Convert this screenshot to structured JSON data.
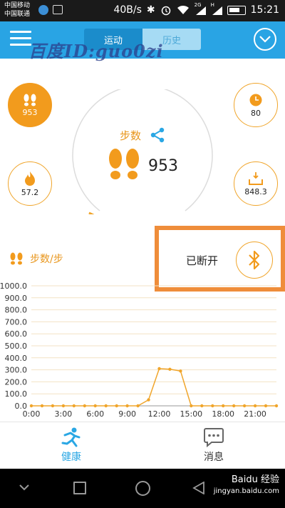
{
  "status_bar": {
    "carrier_1": "中国移动",
    "carrier_2": "中国联通",
    "net_speed": "40B/s",
    "network_label": "2G",
    "signal_label": "H",
    "time": "15:21"
  },
  "header": {
    "tabs": [
      {
        "label": "运动",
        "active": true
      },
      {
        "label": "历史",
        "active": false
      }
    ],
    "menu_icon": "hamburger-icon",
    "right_icon": "check-circle-icon"
  },
  "watermark": "百度ID:guo0zi",
  "stats": {
    "steps": {
      "value": "953",
      "icon": "footprints-icon"
    },
    "time": {
      "value": "80",
      "icon": "clock-icon"
    },
    "calories": {
      "value": "57.2",
      "icon": "flame-icon"
    },
    "distance": {
      "value": "848.3",
      "icon": "distance-icon"
    }
  },
  "gauge": {
    "title": "步数",
    "value": "953",
    "progress": 0.1
  },
  "chart_section": {
    "label": "步数/步"
  },
  "bluetooth": {
    "status": "已断开",
    "icon": "bluetooth-icon"
  },
  "chart_data": {
    "type": "line",
    "title": "",
    "xlabel": "",
    "ylabel": "步数/步",
    "x_ticks": [
      "0:00",
      "3:00",
      "6:00",
      "9:00",
      "12:00",
      "15:00",
      "18:00",
      "21:00"
    ],
    "y_ticks": [
      "1000.0",
      "900.0",
      "800.0",
      "700.0",
      "600.0",
      "500.0",
      "400.0",
      "300.0",
      "200.0",
      "100.0",
      "0.0"
    ],
    "ylim": [
      0,
      1000
    ],
    "xlim": [
      0,
      23
    ],
    "x": [
      0,
      1,
      2,
      3,
      4,
      5,
      6,
      7,
      8,
      9,
      10,
      11,
      12,
      13,
      14,
      15,
      16,
      17,
      18,
      19,
      20,
      21,
      22,
      23
    ],
    "series": [
      {
        "values": [
          0,
          0,
          0,
          0,
          0,
          0,
          0,
          0,
          0,
          0,
          0,
          50,
          310,
          305,
          290,
          0,
          0,
          0,
          0,
          0,
          0,
          0,
          0,
          0
        ]
      }
    ],
    "color": "#f0a52b",
    "grid": true
  },
  "bottom_nav": {
    "items": [
      {
        "label": "健康",
        "icon": "running-person-icon",
        "active": true
      },
      {
        "label": "消息",
        "icon": "chat-bubble-icon",
        "active": false
      }
    ]
  },
  "system_nav": {
    "baidu_logo_text": "Baidu 经验",
    "baidu_url": "jingyan.baidu.com"
  }
}
